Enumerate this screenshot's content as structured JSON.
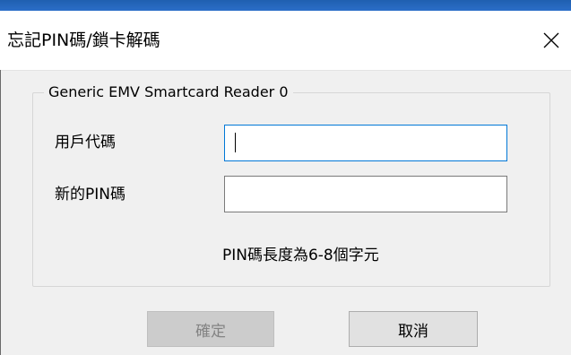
{
  "window": {
    "title": "忘記PIN碼/鎖卡解碼",
    "accent_color": "#2b6ec8"
  },
  "group": {
    "legend": "Generic EMV Smartcard Reader 0"
  },
  "fields": {
    "user_code_label": "用戶代碼",
    "user_code_value": "",
    "new_pin_label": "新的PIN碼",
    "new_pin_value": ""
  },
  "hint": "PIN碼長度為6-8個字元",
  "buttons": {
    "ok_label": "確定",
    "ok_enabled": false,
    "cancel_label": "取消"
  },
  "icons": {
    "close": "close-icon"
  }
}
